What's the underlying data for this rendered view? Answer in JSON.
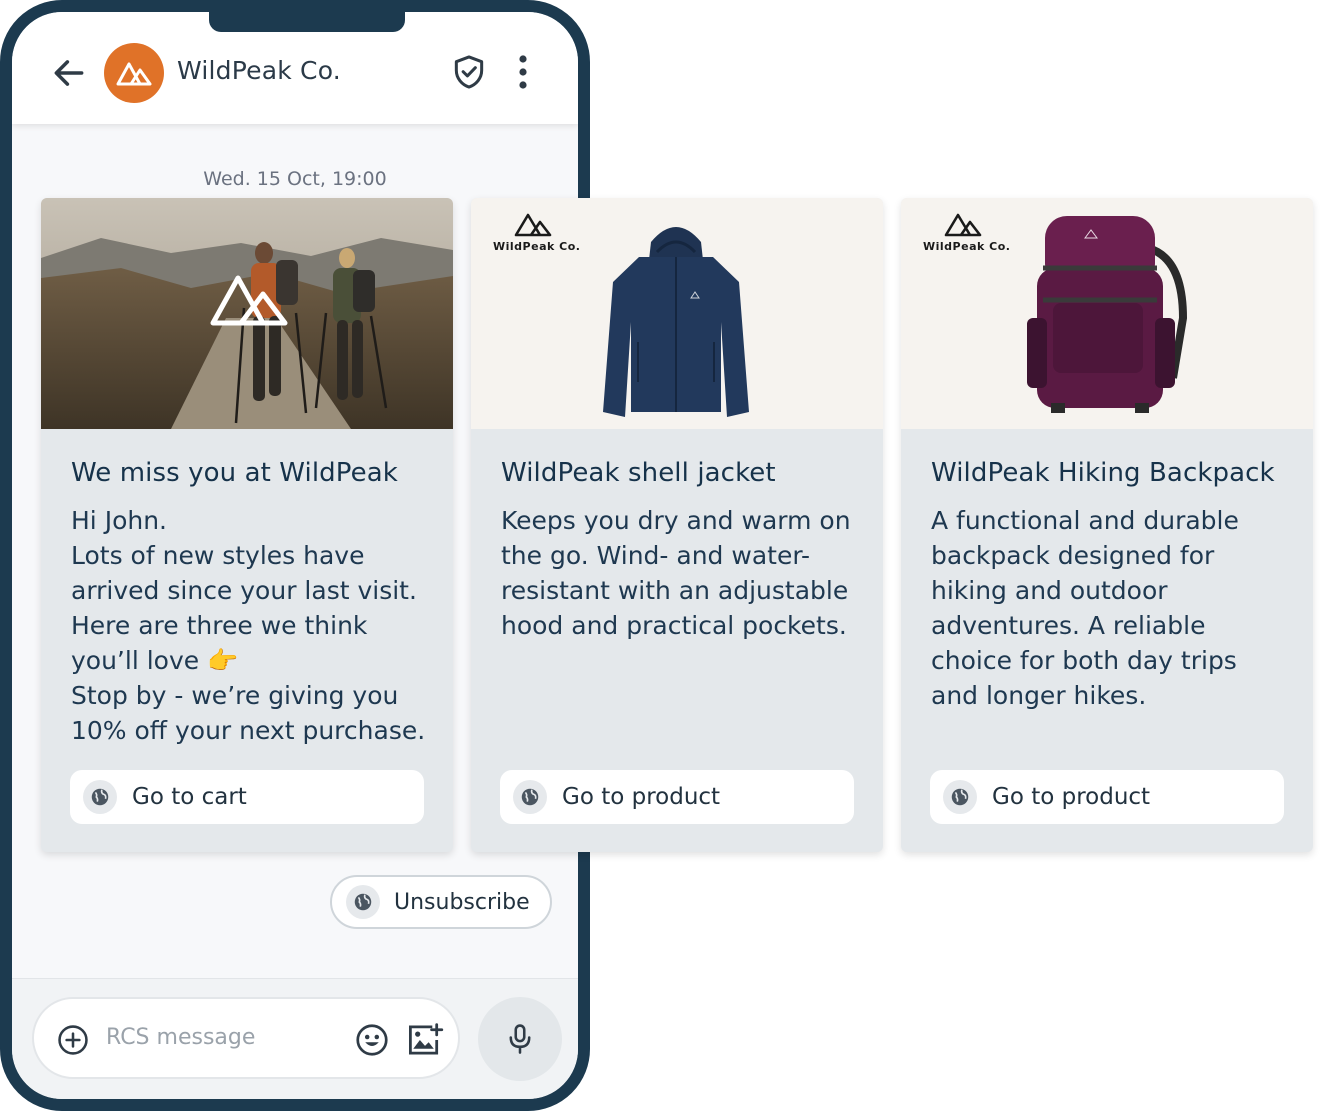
{
  "app": {
    "brand_name": "WildPeak Co.",
    "accent_color": "#e07228",
    "frame_color": "#1c3a4f"
  },
  "conversation": {
    "timestamp": "Wed. 15 Oct, 19:00"
  },
  "cards": [
    {
      "title": "We miss you at WildPeak",
      "body": "Hi John.\nLots of new styles have arrived since your last visit. Here are three we think you’ll love 👉\nStop by - we’re giving you 10% off your next purchase.",
      "button": "Go to cart",
      "image": "hikers-photo"
    },
    {
      "title": "WildPeak shell jacket",
      "body": "Keeps you dry and warm on the go. Wind- and water-resistant with an adjustable hood and practical pockets.",
      "button": "Go to product",
      "image": "jacket-photo",
      "logo_text": "WildPeak Co."
    },
    {
      "title": "WildPeak Hiking Backpack",
      "body": "A functional and durable backpack designed for hiking and outdoor adventures. A reliable choice for both day trips and longer hikes.",
      "button": "Go to product",
      "image": "backpack-photo",
      "logo_text": "WildPeak Co."
    }
  ],
  "suggestion": {
    "unsubscribe_label": "Unsubscribe"
  },
  "composer": {
    "placeholder": "RCS message"
  },
  "icons": [
    "back-arrow-icon",
    "mountain-logo-icon",
    "shield-check-icon",
    "more-vert-icon",
    "globe-icon",
    "add-circle-icon",
    "emoji-icon",
    "add-image-icon",
    "mic-icon"
  ]
}
